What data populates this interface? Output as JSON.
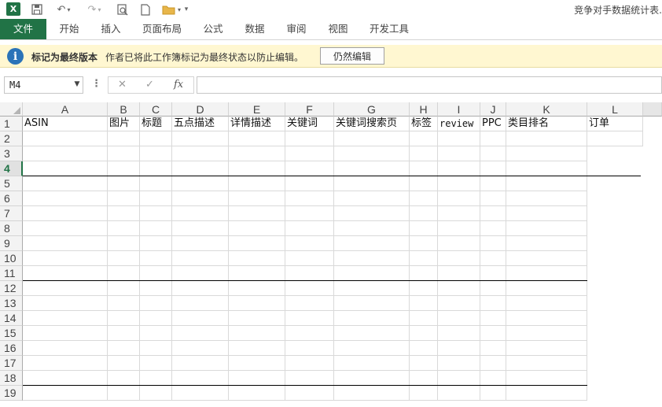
{
  "titlebar": {
    "app_icon": "X",
    "title": "竞争对手数据统计表."
  },
  "ribbon": {
    "tabs": [
      "文件",
      "开始",
      "插入",
      "页面布局",
      "公式",
      "数据",
      "审阅",
      "视图",
      "开发工具"
    ]
  },
  "message_bar": {
    "title": "标记为最终版本",
    "text": "作者已将此工作簿标记为最终状态以防止编辑。",
    "button": "仍然编辑"
  },
  "formula_bar": {
    "name_box": "M4",
    "cancel_icon": "✕",
    "enter_icon": "✓",
    "fx_label": "fx",
    "formula_value": ""
  },
  "sheet": {
    "columns": [
      "A",
      "B",
      "C",
      "D",
      "E",
      "F",
      "G",
      "H",
      "I",
      "J",
      "K",
      "L"
    ],
    "rows": [
      "1",
      "2",
      "3",
      "4",
      "5",
      "6",
      "7",
      "8",
      "9",
      "10",
      "11",
      "12",
      "13",
      "14",
      "15",
      "16",
      "17",
      "18",
      "19"
    ],
    "active_row": "4",
    "header_cells": [
      "ASIN",
      "图片",
      "标题",
      "五点描述",
      "详情描述",
      "关键词",
      "关键词搜索页",
      "标签",
      "review",
      "PPC",
      "类目排名",
      "订单"
    ]
  }
}
